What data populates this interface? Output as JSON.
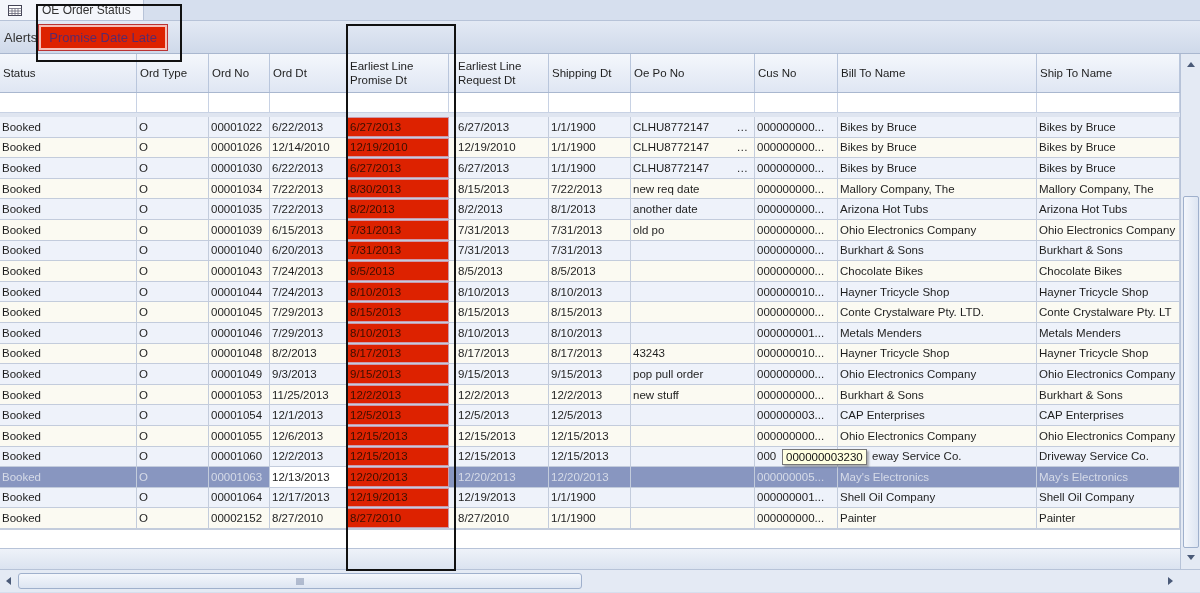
{
  "tab": {
    "label": "OE Order Status",
    "selected": true
  },
  "alerts": {
    "label": "Alerts",
    "buttons": [
      {
        "label": "Promise Date Late",
        "color": "#dd2200"
      }
    ]
  },
  "table": {
    "columns": [
      {
        "label": "Status",
        "flagged": false
      },
      {
        "label": "Ord Type",
        "flagged": false
      },
      {
        "label": "Ord No",
        "flagged": false
      },
      {
        "label": "Ord Dt",
        "flagged": false
      },
      {
        "label": "Earliest Line Promise Dt",
        "flagged": true
      },
      {
        "label": "Earliest Line Request Dt",
        "flagged": false
      },
      {
        "label": "Shipping Dt",
        "flagged": false
      },
      {
        "label": "Oe Po No",
        "flagged": false
      },
      {
        "label": "Cus No",
        "flagged": false
      },
      {
        "label": "Bill To Name",
        "flagged": false
      },
      {
        "label": "Ship To Name",
        "flagged": false
      }
    ],
    "rows": [
      {
        "status": "Booked",
        "ord_type": "O",
        "ord_no": "00001022",
        "ord_dt": "6/22/2013",
        "promise_dt": "6/27/2013",
        "request_dt": "6/27/2013",
        "shipping_dt": "1/1/1900",
        "po_no": "CLHU8772147",
        "po_button": "…",
        "cus_no": "000000000...",
        "bill_to": "Bikes by Bruce",
        "ship_to": "Bikes by Bruce",
        "selected": false
      },
      {
        "status": "Booked",
        "ord_type": "O",
        "ord_no": "00001026",
        "ord_dt": "12/14/2010",
        "promise_dt": "12/19/2010",
        "request_dt": "12/19/2010",
        "shipping_dt": "1/1/1900",
        "po_no": "CLHU8772147",
        "po_button": "…",
        "cus_no": "000000000...",
        "bill_to": "Bikes by Bruce",
        "ship_to": "Bikes by Bruce",
        "selected": false
      },
      {
        "status": "Booked",
        "ord_type": "O",
        "ord_no": "00001030",
        "ord_dt": "6/22/2013",
        "promise_dt": "6/27/2013",
        "request_dt": "6/27/2013",
        "shipping_dt": "1/1/1900",
        "po_no": "CLHU8772147",
        "po_button": "…",
        "cus_no": "000000000...",
        "bill_to": "Bikes by Bruce",
        "ship_to": "Bikes by Bruce",
        "selected": false
      },
      {
        "status": "Booked",
        "ord_type": "O",
        "ord_no": "00001034",
        "ord_dt": "7/22/2013",
        "promise_dt": "8/30/2013",
        "request_dt": "8/15/2013",
        "shipping_dt": "7/22/2013",
        "po_no": "new req date",
        "cus_no": "000000000...",
        "bill_to": "Mallory Company, The",
        "ship_to": "Mallory Company, The",
        "selected": false
      },
      {
        "status": "Booked",
        "ord_type": "O",
        "ord_no": "00001035",
        "ord_dt": "7/22/2013",
        "promise_dt": "8/2/2013",
        "request_dt": "8/2/2013",
        "shipping_dt": "8/1/2013",
        "po_no": "another date",
        "cus_no": "000000000...",
        "bill_to": "Arizona Hot Tubs",
        "ship_to": "Arizona Hot Tubs",
        "selected": false
      },
      {
        "status": "Booked",
        "ord_type": "O",
        "ord_no": "00001039",
        "ord_dt": "6/15/2013",
        "promise_dt": "7/31/2013",
        "request_dt": "7/31/2013",
        "shipping_dt": "7/31/2013",
        "po_no": "old po",
        "cus_no": "000000000...",
        "bill_to": "Ohio Electronics Company",
        "ship_to": "Ohio Electronics Company",
        "selected": false
      },
      {
        "status": "Booked",
        "ord_type": "O",
        "ord_no": "00001040",
        "ord_dt": "6/20/2013",
        "promise_dt": "7/31/2013",
        "request_dt": "7/31/2013",
        "shipping_dt": "7/31/2013",
        "cus_no": "000000000...",
        "bill_to": "Burkhart & Sons",
        "ship_to": "Burkhart & Sons",
        "selected": false
      },
      {
        "status": "Booked",
        "ord_type": "O",
        "ord_no": "00001043",
        "ord_dt": "7/24/2013",
        "promise_dt": "8/5/2013",
        "request_dt": "8/5/2013",
        "shipping_dt": "8/5/2013",
        "cus_no": "000000000...",
        "bill_to": "Chocolate Bikes",
        "ship_to": "Chocolate Bikes",
        "selected": false
      },
      {
        "status": "Booked",
        "ord_type": "O",
        "ord_no": "00001044",
        "ord_dt": "7/24/2013",
        "promise_dt": "8/10/2013",
        "request_dt": "8/10/2013",
        "shipping_dt": "8/10/2013",
        "cus_no": "000000010...",
        "bill_to": "Hayner Tricycle Shop",
        "ship_to": "Hayner Tricycle Shop",
        "selected": false
      },
      {
        "status": "Booked",
        "ord_type": "O",
        "ord_no": "00001045",
        "ord_dt": "7/29/2013",
        "promise_dt": "8/15/2013",
        "request_dt": "8/15/2013",
        "shipping_dt": "8/15/2013",
        "cus_no": "000000000...",
        "bill_to": "Conte Crystalware Pty. LTD.",
        "ship_to": "Conte Crystalware Pty. LT",
        "selected": false
      },
      {
        "status": "Booked",
        "ord_type": "O",
        "ord_no": "00001046",
        "ord_dt": "7/29/2013",
        "promise_dt": "8/10/2013",
        "request_dt": "8/10/2013",
        "shipping_dt": "8/10/2013",
        "cus_no": "000000001...",
        "bill_to": "Metals Menders",
        "ship_to": "Metals Menders",
        "selected": false
      },
      {
        "status": "Booked",
        "ord_type": "O",
        "ord_no": "00001048",
        "ord_dt": "8/2/2013",
        "promise_dt": "8/17/2013",
        "request_dt": "8/17/2013",
        "shipping_dt": "8/17/2013",
        "po_no": "43243",
        "cus_no": "000000010...",
        "bill_to": "Hayner Tricycle Shop",
        "ship_to": "Hayner Tricycle Shop",
        "selected": false
      },
      {
        "status": "Booked",
        "ord_type": "O",
        "ord_no": "00001049",
        "ord_dt": "9/3/2013",
        "promise_dt": "9/15/2013",
        "request_dt": "9/15/2013",
        "shipping_dt": "9/15/2013",
        "po_no": "pop pull order",
        "cus_no": "000000000...",
        "bill_to": "Ohio Electronics Company",
        "ship_to": "Ohio Electronics Company",
        "selected": false
      },
      {
        "status": "Booked",
        "ord_type": "O",
        "ord_no": "00001053",
        "ord_dt": "11/25/2013",
        "promise_dt": "12/2/2013",
        "request_dt": "12/2/2013",
        "shipping_dt": "12/2/2013",
        "po_no": "new stuff",
        "cus_no": "000000000...",
        "bill_to": "Burkhart & Sons",
        "ship_to": "Burkhart & Sons",
        "selected": false
      },
      {
        "status": "Booked",
        "ord_type": "O",
        "ord_no": "00001054",
        "ord_dt": "12/1/2013",
        "promise_dt": "12/5/2013",
        "request_dt": "12/5/2013",
        "shipping_dt": "12/5/2013",
        "cus_no": "000000003...",
        "bill_to": "CAP Enterprises",
        "ship_to": "CAP Enterprises",
        "selected": false
      },
      {
        "status": "Booked",
        "ord_type": "O",
        "ord_no": "00001055",
        "ord_dt": "12/6/2013",
        "promise_dt": "12/15/2013",
        "request_dt": "12/15/2013",
        "shipping_dt": "12/15/2013",
        "cus_no": "000000000...",
        "bill_to": "Ohio Electronics Company",
        "ship_to": "Ohio Electronics Company",
        "selected": false
      },
      {
        "status": "Booked",
        "ord_type": "O",
        "ord_no": "00001060",
        "ord_dt": "12/2/2013",
        "promise_dt": "12/15/2013",
        "request_dt": "12/15/2013",
        "shipping_dt": "12/15/2013",
        "cus_no": "000",
        "bill_to": "eway Service Co.",
        "ship_to": "Driveway Service Co.",
        "tooltip": "000000003230",
        "selected": false
      },
      {
        "status": "Booked",
        "ord_type": "O",
        "ord_no": "00001063",
        "ord_dt": "12/13/2013",
        "promise_dt": "12/20/2013",
        "request_dt": "12/20/2013",
        "shipping_dt": "12/20/2013",
        "cus_no": "000000005...",
        "bill_to": "May's Electronics",
        "ship_to": "May's Electronics",
        "selected": true,
        "ord_dt_focused": true
      },
      {
        "status": "Booked",
        "ord_type": "O",
        "ord_no": "00001064",
        "ord_dt": "12/17/2013",
        "promise_dt": "12/19/2013",
        "request_dt": "12/19/2013",
        "shipping_dt": "1/1/1900",
        "cus_no": "000000001...",
        "bill_to": "Shell Oil Company",
        "ship_to": "Shell Oil Company",
        "selected": false
      },
      {
        "status": "Booked",
        "ord_type": "O",
        "ord_no": "00002152",
        "ord_dt": "8/27/2010",
        "promise_dt": "8/27/2010",
        "request_dt": "8/27/2010",
        "shipping_dt": "1/1/1900",
        "cus_no": "000000000...",
        "bill_to": "Painter",
        "ship_to": "Painter",
        "selected": false
      }
    ]
  }
}
